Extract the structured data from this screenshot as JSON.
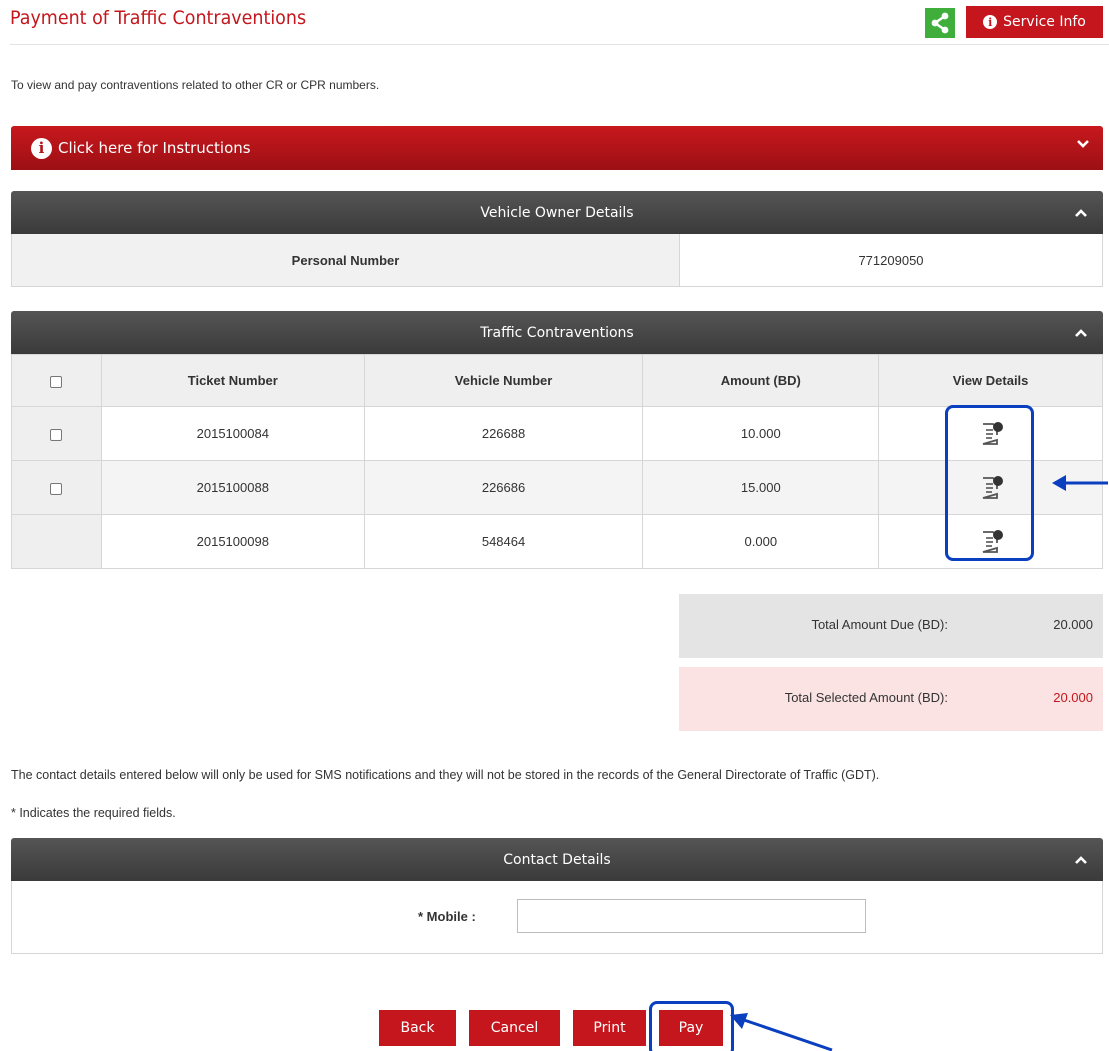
{
  "header": {
    "title": "Payment of Traffic Contraventions",
    "service_info_label": "Service Info",
    "share_icon": "share-icon",
    "accent_color": "#c4161c"
  },
  "intro": "To view and pay contraventions related to other CR or CPR numbers.",
  "instructions": {
    "label": "Click here for Instructions"
  },
  "vehicle_owner": {
    "title": "Vehicle Owner Details",
    "label": "Personal Number",
    "value": "771209050"
  },
  "contraventions": {
    "title": "Traffic Contraventions",
    "columns": [
      "Ticket Number",
      "Vehicle Number",
      "Amount (BD)",
      "View Details"
    ],
    "rows": [
      {
        "ticket": "2015100084",
        "vehicle": "226688",
        "amount": "10.000",
        "selectable": true
      },
      {
        "ticket": "2015100088",
        "vehicle": "226686",
        "amount": "15.000",
        "selectable": true
      },
      {
        "ticket": "2015100098",
        "vehicle": "548464",
        "amount": "0.000",
        "selectable": false
      }
    ]
  },
  "totals": {
    "due_label": "Total Amount Due (BD):",
    "due_value": "20.000",
    "selected_label": "Total Selected Amount (BD):",
    "selected_value": "20.000"
  },
  "notes": {
    "sms": "The contact details entered below will only be used for SMS notifications and they will not be stored in the records of the General Directorate of Traffic (GDT).",
    "required": "* Indicates the required fields."
  },
  "contact": {
    "title": "Contact Details",
    "mobile_label": "* Mobile :",
    "mobile_value": ""
  },
  "buttons": {
    "back": "Back",
    "cancel": "Cancel",
    "print": "Print",
    "pay": "Pay"
  }
}
